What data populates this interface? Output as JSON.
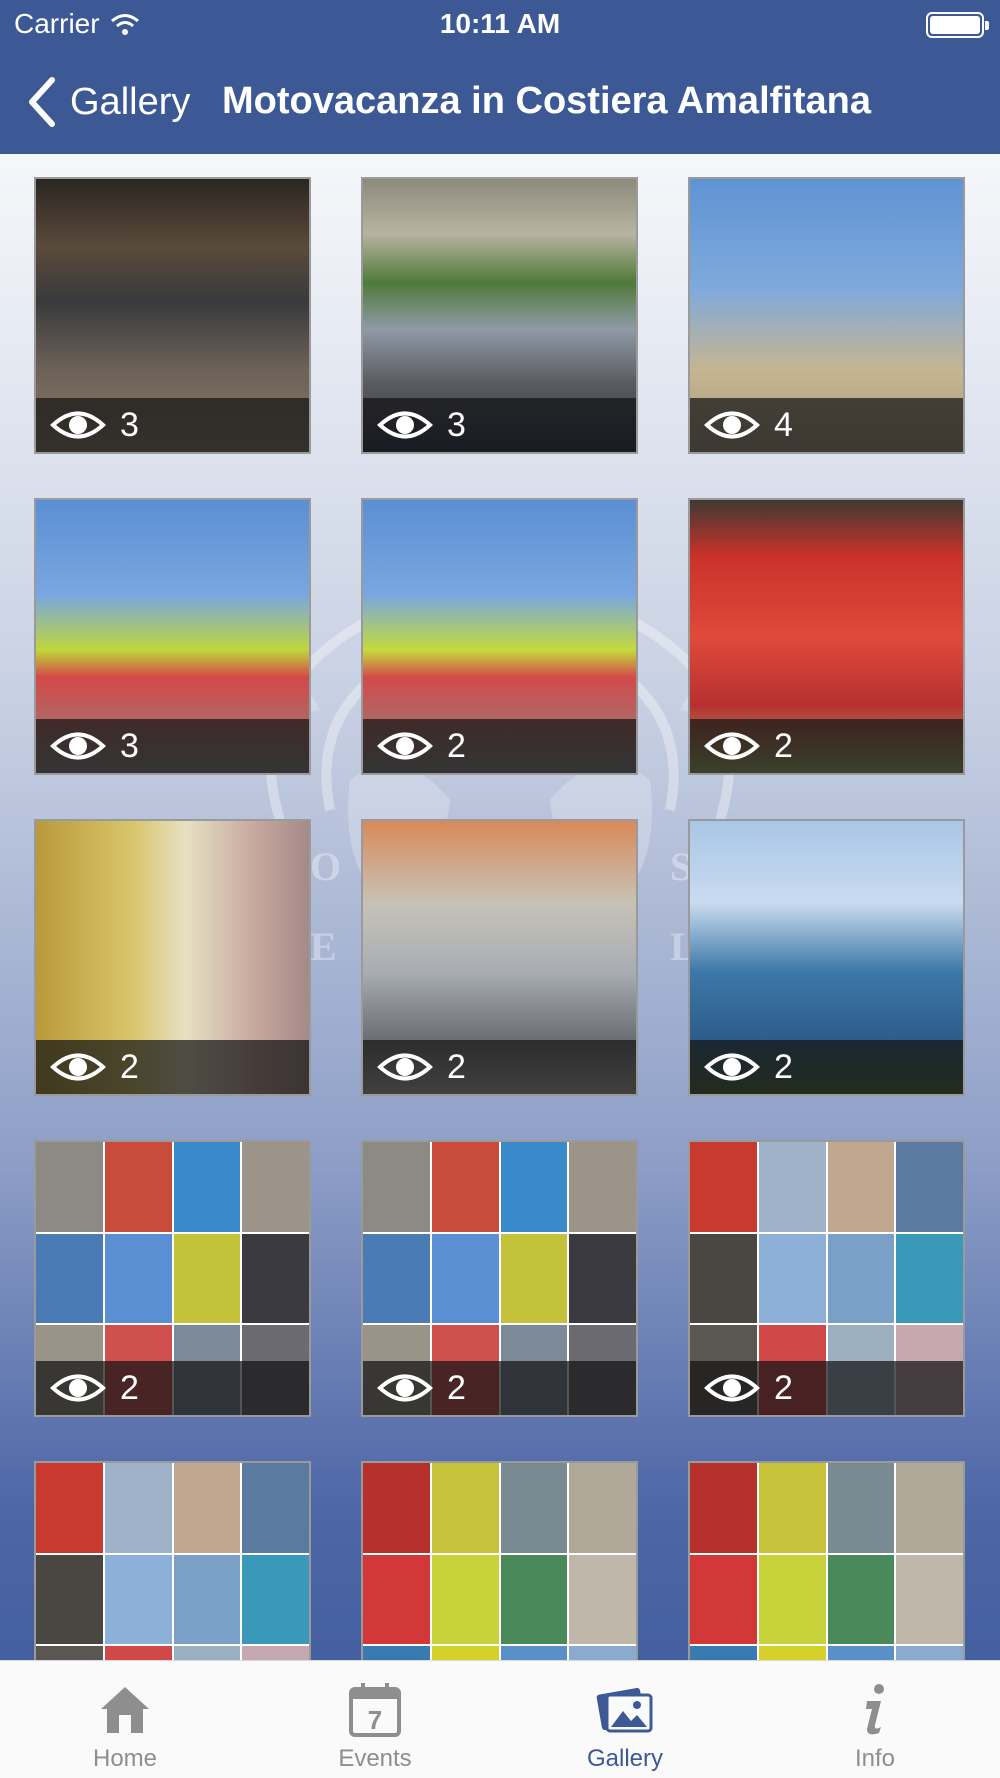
{
  "status_bar": {
    "carrier": "Carrier",
    "time": "10:11 AM"
  },
  "nav": {
    "back_label": "Gallery",
    "title": "Motovacanza in Costiera Amalfitana"
  },
  "colors": {
    "nav_background": "#3c5996",
    "tab_active": "#3c5996",
    "tab_inactive": "#8e8e8e"
  },
  "gallery": {
    "items": [
      {
        "views": "3",
        "kind": "photo",
        "scene": "night-street-motorbikes"
      },
      {
        "views": "3",
        "kind": "photo",
        "scene": "woman-roadside"
      },
      {
        "views": "4",
        "kind": "photo",
        "scene": "group-sea-view"
      },
      {
        "views": "3",
        "kind": "photo",
        "scene": "three-people-palm"
      },
      {
        "views": "2",
        "kind": "photo",
        "scene": "four-people-palm"
      },
      {
        "views": "2",
        "kind": "photo",
        "scene": "market-peppers"
      },
      {
        "views": "2",
        "kind": "photo",
        "scene": "limoncello-shop-woman"
      },
      {
        "views": "2",
        "kind": "photo",
        "scene": "silver-motorbike"
      },
      {
        "views": "2",
        "kind": "photo",
        "scene": "sea-coast"
      },
      {
        "views": "2",
        "kind": "collage",
        "scene": "collage-a"
      },
      {
        "views": "2",
        "kind": "collage",
        "scene": "collage-a"
      },
      {
        "views": "2",
        "kind": "collage",
        "scene": "collage-b"
      },
      {
        "views": "",
        "kind": "collage",
        "scene": "collage-b"
      },
      {
        "views": "",
        "kind": "collage",
        "scene": "collage-c"
      },
      {
        "views": "",
        "kind": "collage",
        "scene": "collage-c"
      }
    ]
  },
  "tabs": [
    {
      "label": "Home",
      "icon": "home-icon",
      "active": false
    },
    {
      "label": "Events",
      "icon": "calendar-icon",
      "active": false,
      "badge": "7"
    },
    {
      "label": "Gallery",
      "icon": "photos-icon",
      "active": true
    },
    {
      "label": "Info",
      "icon": "info-icon",
      "active": false
    }
  ]
}
